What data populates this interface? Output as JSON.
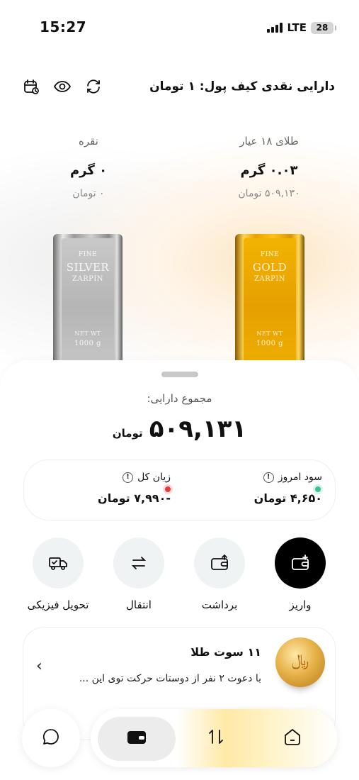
{
  "status": {
    "time": "15:27",
    "network": "LTE",
    "battery": "28"
  },
  "header": {
    "title": "دارایی نقدی کیف پول: ۱ تومان",
    "icons": [
      "calendar-icon",
      "eye-icon",
      "refresh-icon"
    ]
  },
  "metals": {
    "gold": {
      "name": "طلای ۱۸ عیار",
      "gram": "۰.۰۳ گرم",
      "toman": "۵۰۹,۱۳۰ تومان",
      "bar_top": "FINE",
      "bar_metal": "GOLD",
      "bar_brand": "ZARPIN",
      "bar_weight_label": "NET WT",
      "bar_weight": "1000 g"
    },
    "silver": {
      "name": "نقره",
      "gram": "۰ گرم",
      "toman": "۰ تومان",
      "bar_top": "FINE",
      "bar_metal": "SILVER",
      "bar_brand": "ZARPIN",
      "bar_weight_label": "NET WT",
      "bar_weight": "1000 g"
    }
  },
  "summary": {
    "label": "مجموع دارایی:",
    "amount": "۵۰۹,۱۳۱",
    "unit": "تومان"
  },
  "profit_loss": {
    "today": {
      "title": "سود امروز",
      "value": "۴,۶۵۰ تومان",
      "color": "#3fbf95"
    },
    "total": {
      "title": "زیان کل",
      "value": "-۷,۹۹۰ تومان",
      "color": "#e53b3b"
    }
  },
  "actions": {
    "deposit": "واریز",
    "withdraw": "برداشت",
    "transfer": "انتقال",
    "delivery": "تحویل فیزیکی"
  },
  "promo": {
    "title": "۱۱ سوت طلا",
    "description": "با دعوت ۲ نفر از دوستات حرکت توی این ..."
  },
  "nav": {
    "items": [
      "chat-icon",
      "wallet-icon",
      "swap-icon",
      "home-icon"
    ]
  },
  "colors": {
    "accent": "#000000",
    "gold": "#e8a300",
    "silver": "#b5b5b5"
  }
}
